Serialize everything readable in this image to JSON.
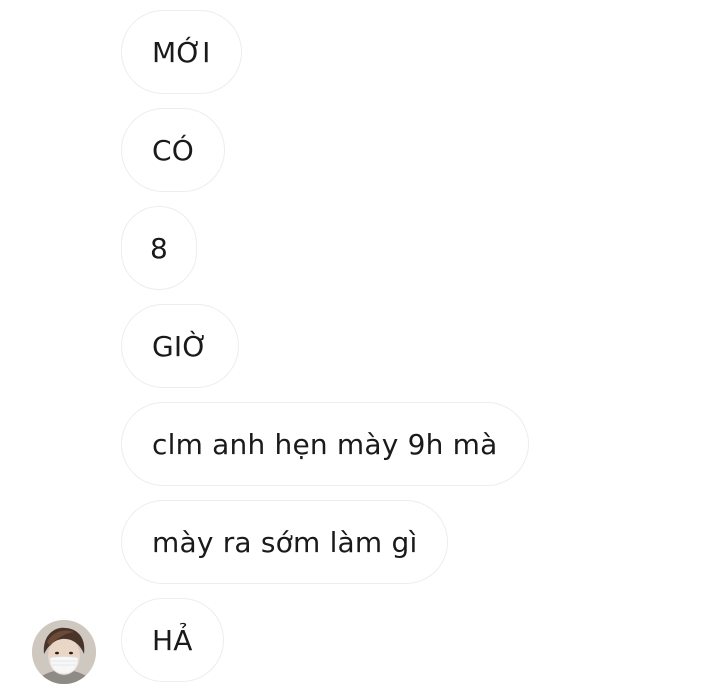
{
  "messages": [
    {
      "text": "MỚI"
    },
    {
      "text": "CÓ"
    },
    {
      "text": "8"
    },
    {
      "text": "GIỜ"
    },
    {
      "text": "clm anh hẹn mày 9h mà"
    },
    {
      "text": "mày ra sớm làm gì"
    },
    {
      "text": "HẢ"
    }
  ],
  "colors": {
    "background": "#ffffff",
    "bubble_border": "#ededed",
    "text": "#1a1a1a"
  },
  "icons": {
    "avatar": "sender-avatar"
  }
}
